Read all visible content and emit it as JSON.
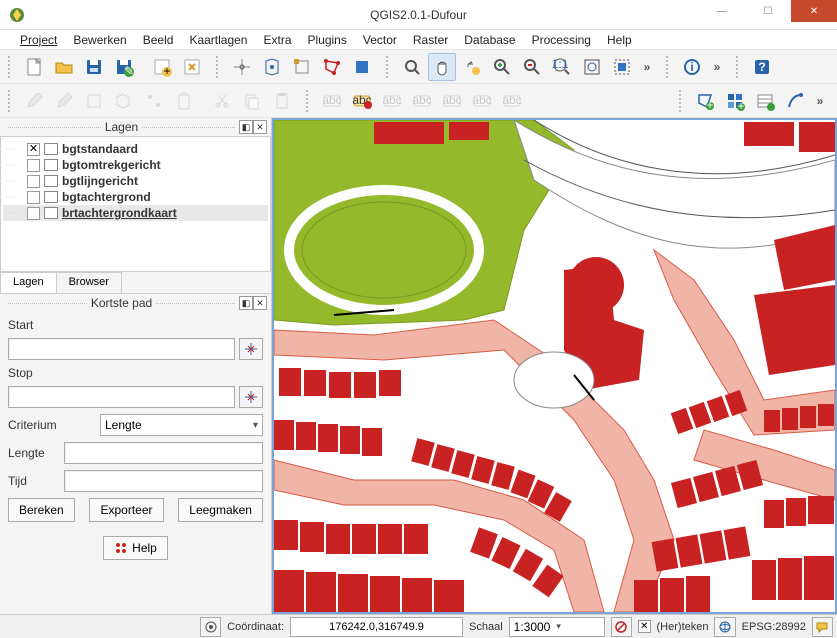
{
  "window": {
    "title": "QGIS2.0.1-Dufour"
  },
  "menu": {
    "items": [
      "Project",
      "Bewerken",
      "Beeld",
      "Kaartlagen",
      "Extra",
      "Plugins",
      "Vector",
      "Raster",
      "Database",
      "Processing",
      "Help"
    ]
  },
  "toolbar1_icons": [
    "new",
    "open",
    "save",
    "save-as",
    "new-layer",
    "show-layer",
    "target",
    "measure",
    "zoom-native",
    "polygon",
    "square",
    "zoom-extent",
    "pan",
    "pan-select",
    "zoom-in",
    "zoom-out",
    "zoom-full",
    "zoom-last",
    "zoom-next",
    "identify",
    "options",
    "help"
  ],
  "toolbar2_icons": [
    "edit-pencil",
    "edit-pencil2",
    "vertex",
    "poly",
    "pt",
    "select",
    "cut",
    "copy",
    "paste",
    "abc1",
    "abc2",
    "abc3",
    "abc4",
    "abc5",
    "abc6",
    "abc7",
    "node",
    "pattern",
    "chart",
    "feather"
  ],
  "layers_panel": {
    "title": "Lagen",
    "layers": [
      {
        "checked": true,
        "name": "bgtstandaard"
      },
      {
        "checked": false,
        "name": "bgtomtrekgericht"
      },
      {
        "checked": false,
        "name": "bgtlijngericht"
      },
      {
        "checked": false,
        "name": "bgtachtergrond"
      },
      {
        "checked": false,
        "name": "brtachtergrondkaart",
        "selected": true
      }
    ],
    "tabs": [
      "Lagen",
      "Browser"
    ]
  },
  "shortest_path": {
    "title": "Kortste pad",
    "start_label": "Start",
    "start_value": "",
    "stop_label": "Stop",
    "stop_value": "",
    "criterium_label": "Criterium",
    "criterium_value": "Lengte",
    "lengte_label": "Lengte",
    "lengte_value": "",
    "tijd_label": "Tijd",
    "tijd_value": "",
    "bereken": "Bereken",
    "exporteer": "Exporteer",
    "leegmaken": "Leegmaken",
    "help": "Help"
  },
  "statusbar": {
    "coord_label": "Coördinaat:",
    "coord_value": "176242.0,316749.9",
    "schaal_label": "Schaal",
    "schaal_value": "1:3000",
    "render_label": "(Her)teken",
    "epsg": "EPSG:28992"
  },
  "colors": {
    "building": "#c92223",
    "grass": "#94b92b",
    "road": "#f1b5a7",
    "road_border": "#d75b46"
  }
}
